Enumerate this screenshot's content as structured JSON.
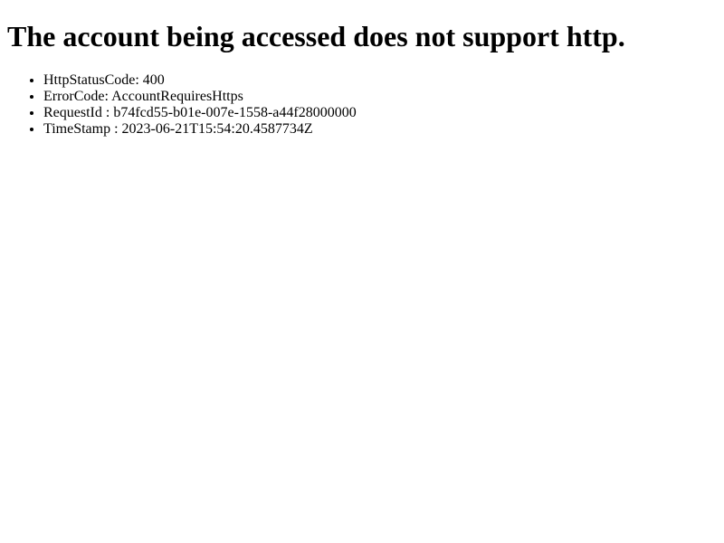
{
  "error": {
    "title": "The account being accessed does not support http.",
    "details": [
      "HttpStatusCode: 400",
      "ErrorCode: AccountRequiresHttps",
      "RequestId : b74fcd55-b01e-007e-1558-a44f28000000",
      "TimeStamp : 2023-06-21T15:54:20.4587734Z"
    ]
  }
}
